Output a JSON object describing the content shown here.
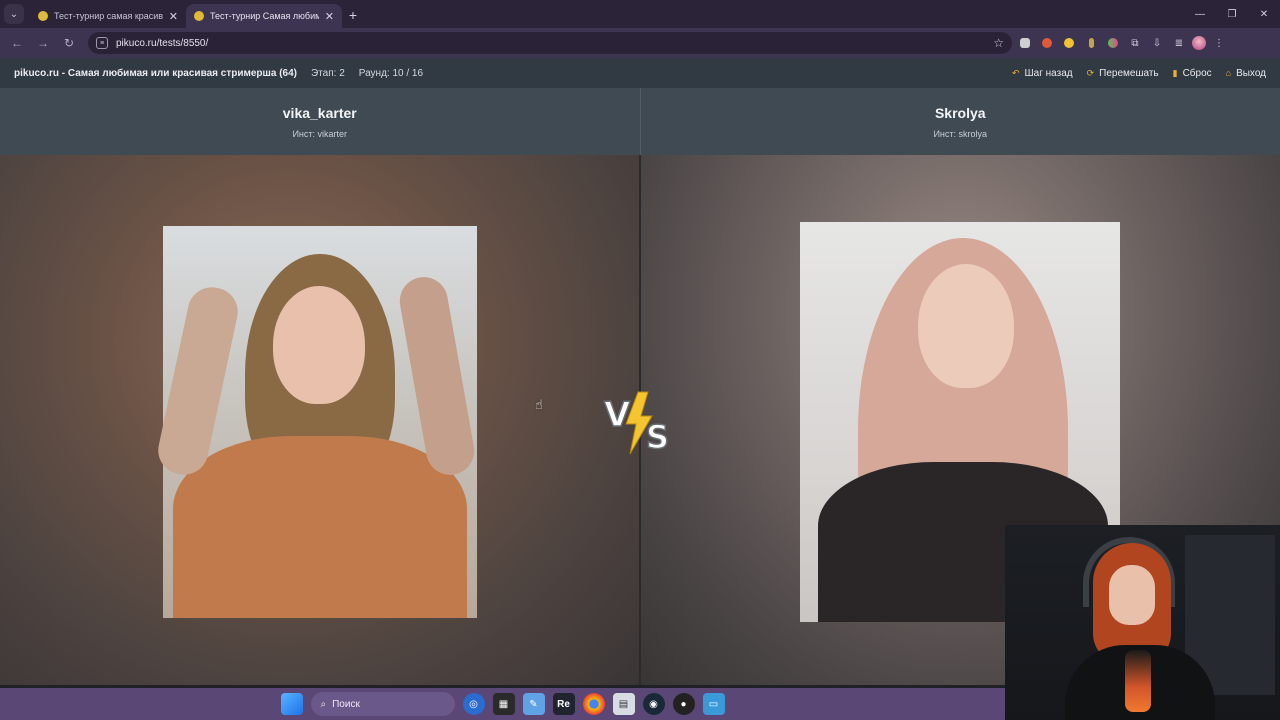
{
  "browser": {
    "tabs": [
      {
        "title": "Тест-турнир самая красивая с",
        "active": false
      },
      {
        "title": "Тест-турнир Самая любимая и",
        "active": true
      }
    ],
    "url": "pikuco.ru/tests/8550/"
  },
  "header": {
    "title": "pikuco.ru - Самая любимая или красивая стримерша (64)",
    "stage": "Этап: 2",
    "round": "Раунд: 10 / 16",
    "actions": {
      "back": "Шаг назад",
      "shuffle": "Перемешать",
      "reset": "Сброс",
      "exit": "Выход"
    }
  },
  "contestants": {
    "left": {
      "name": "vika_karter",
      "insta": "Инст: vikarter"
    },
    "right": {
      "name": "Skrolya",
      "insta": "Инст: skrolya"
    }
  },
  "vs_label": {
    "v": "V",
    "s": "S"
  },
  "taskbar": {
    "search_placeholder": "Поиск",
    "re_label": "Re"
  },
  "colors": {
    "accent": "#e7b233",
    "header_bg": "#313942",
    "names_bg": "#404a53",
    "taskbar_bg": "#5a4775"
  }
}
